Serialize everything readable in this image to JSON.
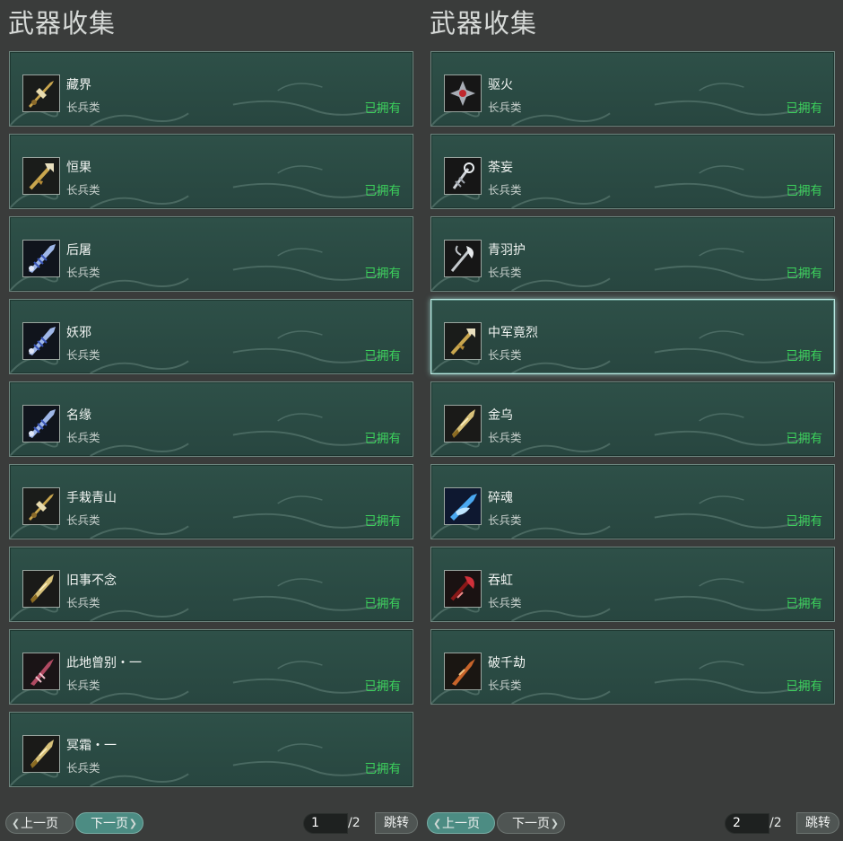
{
  "pages": [
    {
      "title": "武器收集",
      "items": [
        {
          "name": "藏界",
          "type": "长兵类",
          "status": "已拥有",
          "icon": "gold-spear-icon"
        },
        {
          "name": "恒果",
          "type": "长兵类",
          "status": "已拥有",
          "icon": "gold-trident-icon"
        },
        {
          "name": "后屠",
          "type": "长兵类",
          "status": "已拥有",
          "icon": "blue-blade-icon"
        },
        {
          "name": "妖邪",
          "type": "长兵类",
          "status": "已拥有",
          "icon": "blue-blade-icon"
        },
        {
          "name": "名缘",
          "type": "长兵类",
          "status": "已拥有",
          "icon": "blue-blade-icon"
        },
        {
          "name": "手栽青山",
          "type": "长兵类",
          "status": "已拥有",
          "icon": "gold-spear-icon"
        },
        {
          "name": "旧事不念",
          "type": "长兵类",
          "status": "已拥有",
          "icon": "gold-blade-icon"
        },
        {
          "name": "此地曾别・一",
          "type": "长兵类",
          "status": "已拥有",
          "icon": "crimson-spear-icon"
        },
        {
          "name": "冥霜・一",
          "type": "长兵类",
          "status": "已拥有",
          "icon": "gold-blade-icon"
        }
      ],
      "pagination": {
        "prev_label": "上一页",
        "next_label": "下一页",
        "current": "1",
        "total": "/2",
        "jump_label": "跳转"
      }
    },
    {
      "title": "武器收集",
      "items": [
        {
          "name": "驱火",
          "type": "长兵类",
          "status": "已拥有",
          "icon": "red-star-spear-icon"
        },
        {
          "name": "荼妄",
          "type": "长兵类",
          "status": "已拥有",
          "icon": "silver-trident-icon"
        },
        {
          "name": "青羽护",
          "type": "长兵类",
          "status": "已拥有",
          "icon": "silver-halberd-icon"
        },
        {
          "name": "中军竟烈",
          "type": "长兵类",
          "status": "已拥有",
          "icon": "gold-trident-icon"
        },
        {
          "name": "金乌",
          "type": "长兵类",
          "status": "已拥有",
          "icon": "gold-blade-icon"
        },
        {
          "name": "碎魂",
          "type": "长兵类",
          "status": "已拥有",
          "icon": "blue-flame-icon"
        },
        {
          "name": "吞虹",
          "type": "长兵类",
          "status": "已拥有",
          "icon": "red-glaive-icon"
        },
        {
          "name": "破千劫",
          "type": "长兵类",
          "status": "已拥有",
          "icon": "orange-spear-icon"
        }
      ],
      "pagination": {
        "prev_label": "上一页",
        "next_label": "下一页",
        "current": "2",
        "total": "/2",
        "jump_label": "跳转"
      }
    }
  ],
  "colors": {
    "owned": "#3cd25c",
    "card_bg": "#2d4d46",
    "card_border": "#6d857e",
    "selected_border": "#b8e8e0",
    "page_bg": "#3a3c3b"
  }
}
